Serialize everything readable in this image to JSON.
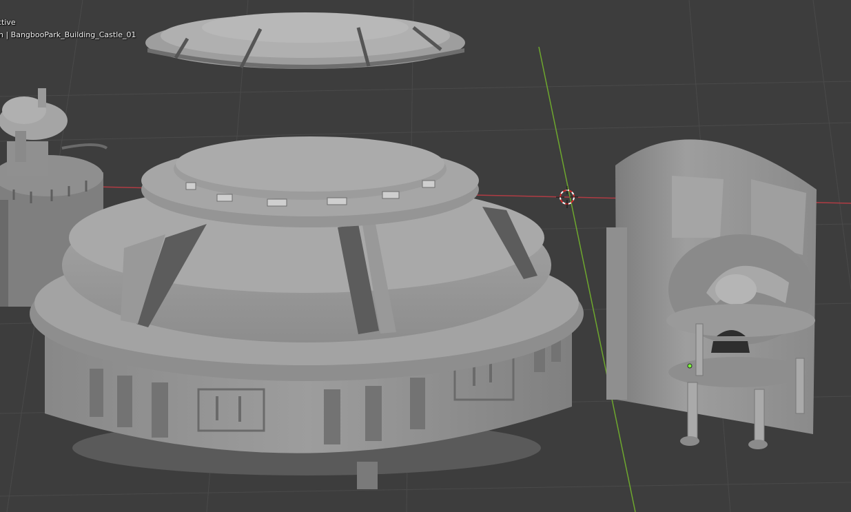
{
  "viewport": {
    "view_mode": "ctive",
    "collection_object": "n | BangbooPark_Building_Castle_01"
  },
  "colors": {
    "background": "#3d3d3d",
    "grid_line": "#4a4a4a",
    "axis_x": "#b13c44",
    "axis_y": "#6ea82e",
    "mesh_base": "#9a9a9a",
    "mesh_light": "#b4b4b4",
    "mesh_shadow": "#5e5e5e",
    "origin_point": "#7cff3a"
  },
  "icons": {
    "cursor": "3d-cursor-icon",
    "origin": "object-origin-icon"
  }
}
